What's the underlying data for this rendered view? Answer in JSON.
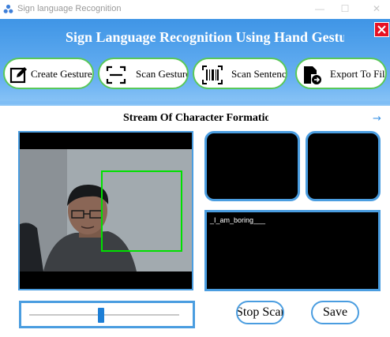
{
  "window": {
    "title": "Sign language Recognition",
    "controls": {
      "minimize": "—",
      "maximize": "☐",
      "close": "✕"
    }
  },
  "header": {
    "title": "Sign Language Recognition Using Hand Gestures",
    "close_symbol": "X",
    "close_color": "#e81123",
    "toolbar": [
      {
        "id": "create",
        "label": "Create Gesture",
        "icon": "edit-icon"
      },
      {
        "id": "scan",
        "label": "Scan Gesture",
        "icon": "scan-icon"
      },
      {
        "id": "sentence",
        "label": "Scan Sentence",
        "icon": "barcode-scan-icon"
      },
      {
        "id": "export",
        "label": "Export To File",
        "icon": "export-file-icon"
      }
    ]
  },
  "main": {
    "stream_title": "Stream Of Character Formation",
    "arrow": "→",
    "recognized_text": "_I_am_boring___",
    "slider": {
      "value": 0.48
    },
    "stop_label": "Stop Scan",
    "save_label": "Save"
  },
  "colors": {
    "accent": "#4a9de0",
    "header_top": "#3f95e6",
    "roi_border": "#00e000",
    "button_border": "#59c859"
  }
}
